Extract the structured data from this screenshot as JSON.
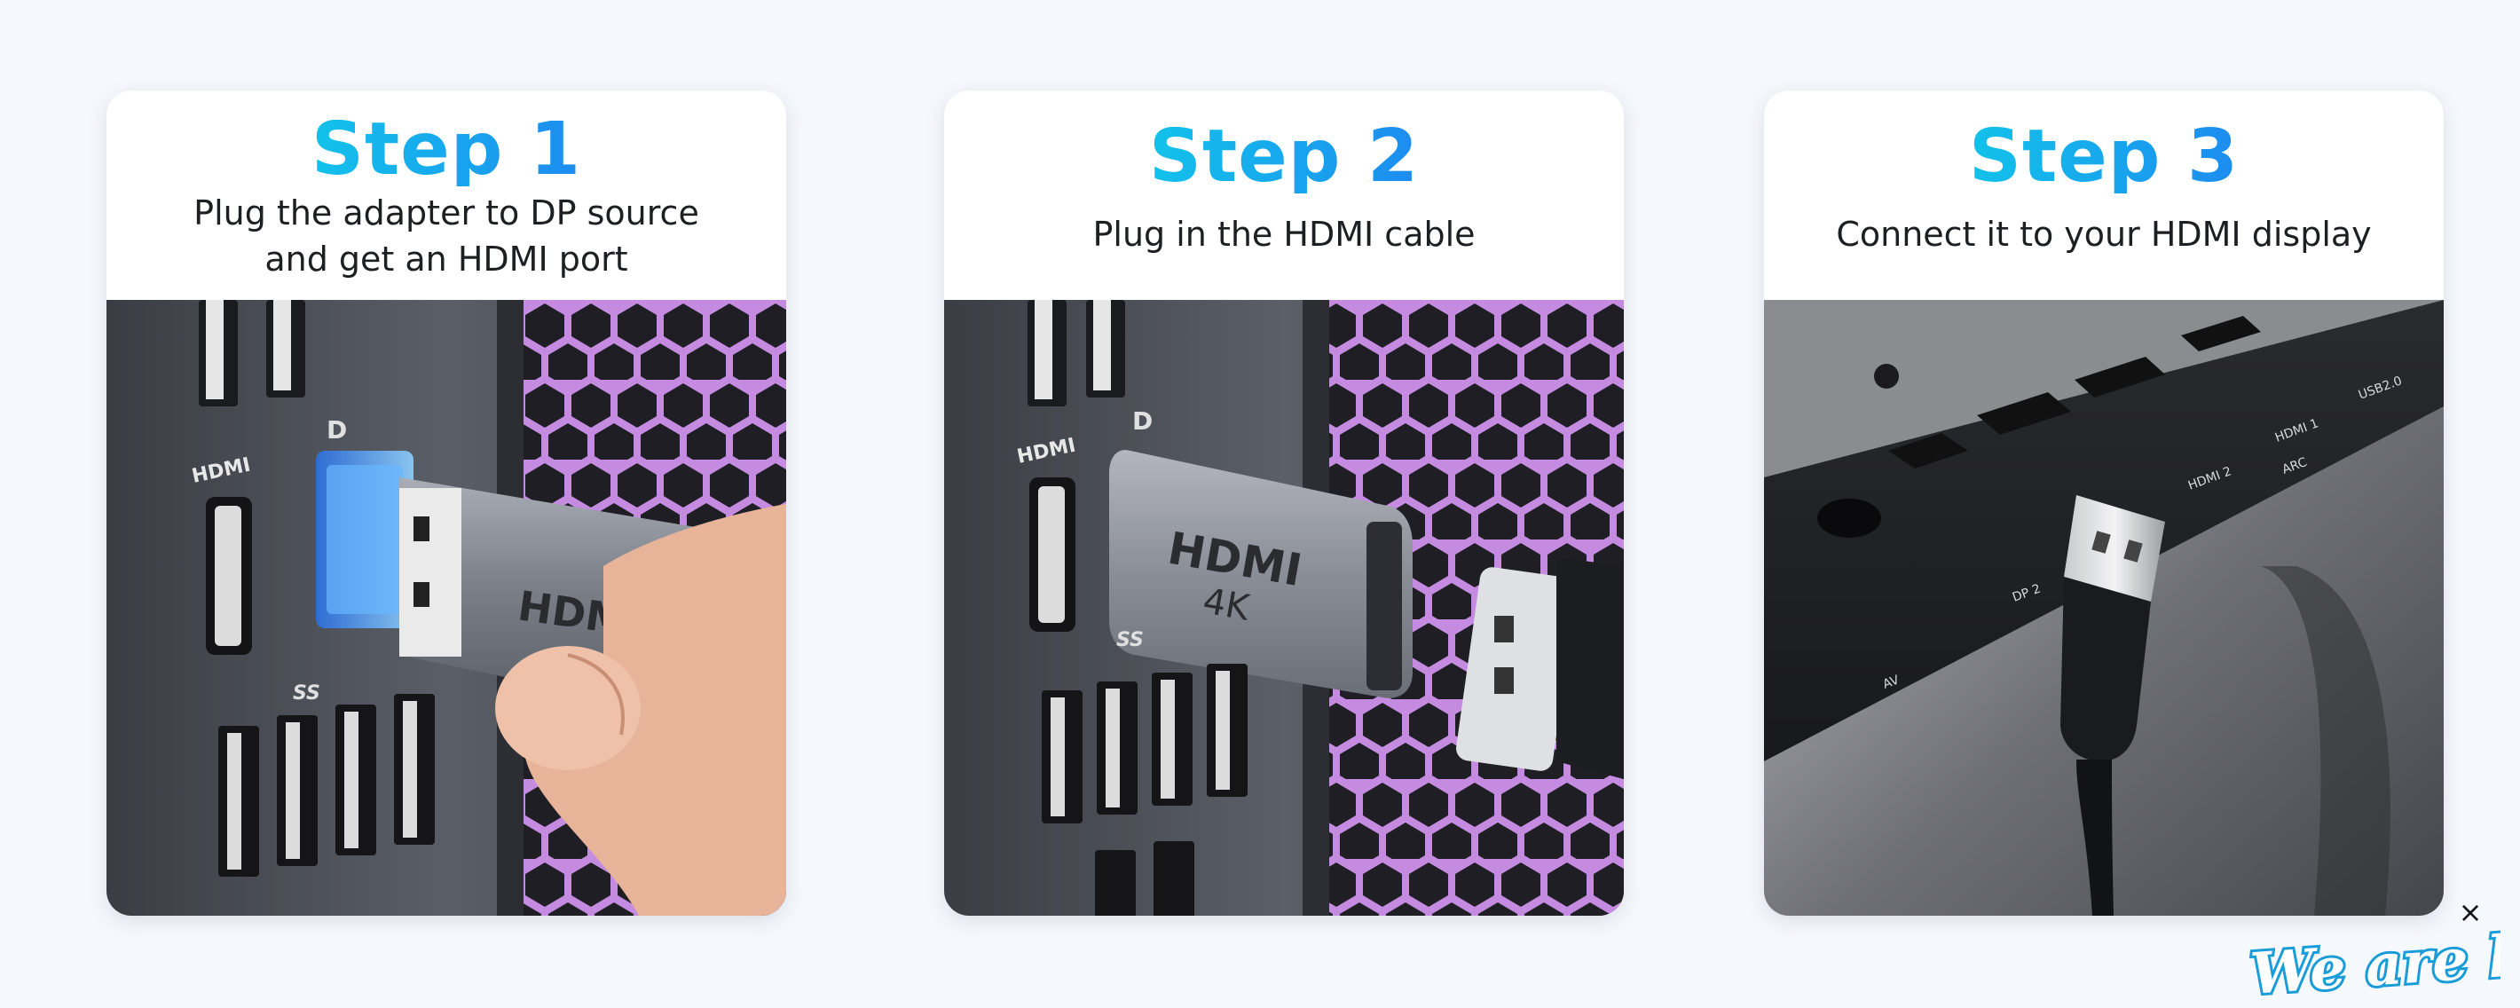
{
  "steps": [
    {
      "title": "Step 1",
      "desc_lines": [
        "Plug the adapter to DP source",
        "and get an HDMI port"
      ],
      "photo_labels": {
        "port_hdmi": "HDMI",
        "port_dp": "D",
        "usb": "SS",
        "adapter_brand": "HDMI"
      }
    },
    {
      "title": "Step 2",
      "desc_lines": [
        "Plug in the HDMI cable"
      ],
      "photo_labels": {
        "port_hdmi": "HDMI",
        "port_dp": "D",
        "usb": "SS",
        "adapter_brand": "HDMI",
        "adapter_sub": "4K"
      }
    },
    {
      "title": "Step 3",
      "desc_lines": [
        "Connect it to your HDMI display"
      ],
      "photo_labels": {
        "hdmi2": "HDMI 2",
        "hdmi1": "HDMI 1",
        "arc": "ARC",
        "usb": "USB2.0",
        "dp2": "DP 2",
        "av": "AV"
      }
    }
  ],
  "chat_widget": {
    "close_symbol": "×",
    "badge_text": "We are here!"
  },
  "colors": {
    "page_bg": "#f5f8fc",
    "title_gradient_start": "#12c2ea",
    "title_gradient_end": "#1d8cf0",
    "text_dark": "#1e1f22",
    "badge_blue": "#1a9cd8"
  },
  "icons": [
    "close-icon",
    "usb-superspeed-icon",
    "displayport-icon"
  ]
}
